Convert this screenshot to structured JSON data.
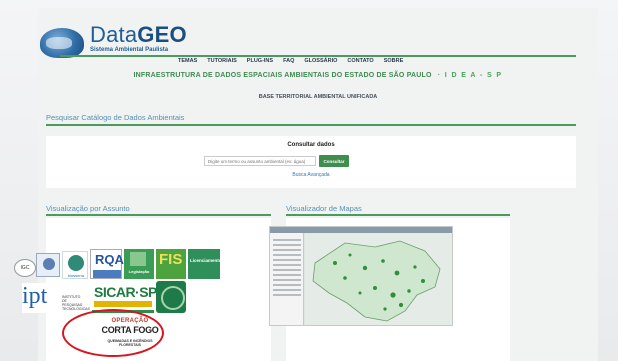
{
  "header": {
    "logo_title_plain": "Data",
    "logo_title_bold": "GEO",
    "logo_subtitle": "Sistema Ambiental Paulista"
  },
  "menu": [
    "TEMAS",
    "TUTORIAIS",
    "PLUG-INS",
    "FAQ",
    "GLOSSÁRIO",
    "CONTATO",
    "SOBRE"
  ],
  "headline": {
    "text": "INFRAESTRUTURA DE DADOS ESPACIAIS AMBIENTAIS DO ESTADO DE SÃO PAULO",
    "acronym": "· I D E A - S P"
  },
  "subhead": "BASE TERRITORIAL AMBIENTAL UNIFICADA",
  "search_section": {
    "label": "Pesquisar Catálogo de Dados Ambientais",
    "title": "Consultar dados",
    "placeholder": "Digite um termo ou assunto ambiental (ex: água)",
    "button": "Consultar",
    "advanced_link": "Busca Avançada"
  },
  "subjects_section": {
    "label": "Visualização por Assunto",
    "logos": {
      "igc": "IGC",
      "bio": "biosserra",
      "rqa": "RQA",
      "legislacao": "Legislação",
      "fis": "FIS",
      "licenciamento": "Licenciamento",
      "ipt": "ipt",
      "ipt_small": "INSTITUTO DE PESQUISAS TECNOLÓGICAS",
      "sicar": "SICAR·SP",
      "corta_l1": "OPERAÇÃO",
      "corta_l2": "CORTA FOGO",
      "corta_l3": "QUEIMADAS E INCÊNDIOS FLORESTAIS"
    }
  },
  "map_section": {
    "label": "Visualizador de Mapas"
  },
  "colors": {
    "accent_green": "#4c9a5e",
    "link_blue": "#2e78b8",
    "highlight_ring": "#d8141c"
  }
}
